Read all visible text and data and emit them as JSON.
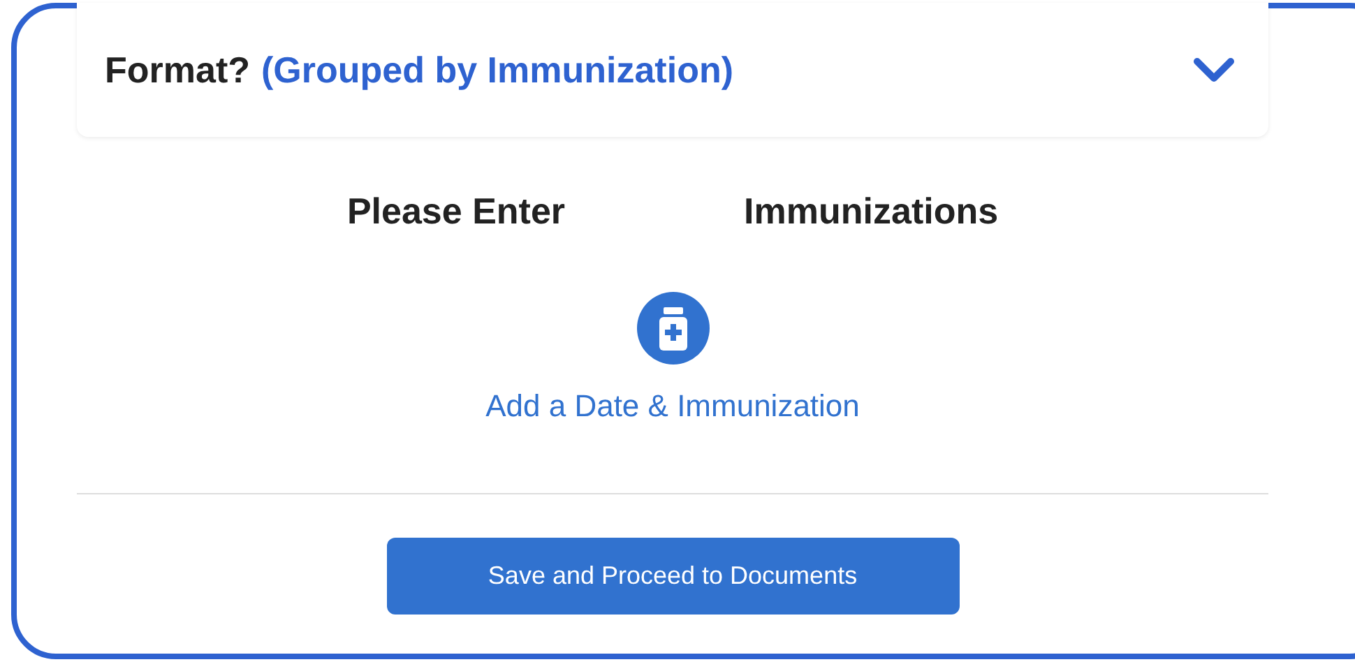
{
  "accordion": {
    "title": "Format?",
    "value": "(Grouped by Immunization)",
    "expanded": false
  },
  "headings": [
    "Please Enter",
    "Immunizations"
  ],
  "add_link": "Add a Date & Immunization",
  "save_button": "Save and Proceed to Documents"
}
